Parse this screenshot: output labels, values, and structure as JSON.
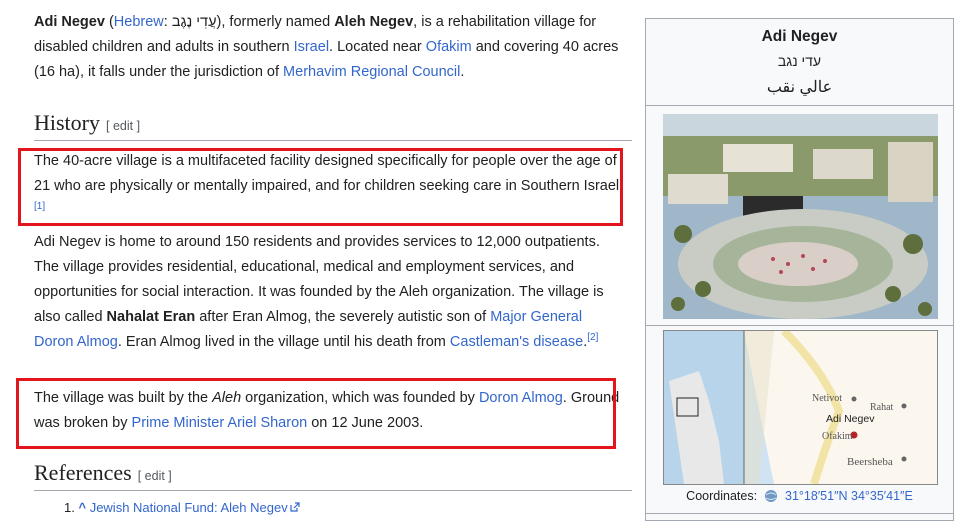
{
  "intro": {
    "title_bold": "Adi Negev",
    "open_paren": " (",
    "hebrew_link": "Hebrew",
    "hebrew_text": ": עֲדִי נֶגֶב",
    "close_part": "), formerly named ",
    "former_name": "Aleh Negev",
    "text1": ", is a rehabilitation village for disabled children and adults in southern ",
    "israel_link": "Israel",
    "text2": ". Located near ",
    "ofakim_link": "Ofakim",
    "text3": " and covering 40 acres (16 ha), it falls under the jurisdiction of ",
    "council_link": "Merhavim Regional Council",
    "text4": "."
  },
  "history": {
    "heading": "History",
    "edit": "[ edit ]",
    "p1": "The 40-acre village is a multifaceted facility designed specifically for people over the age of 21 who are physically or mentally impaired, and for children seeking care in Southern Israel.",
    "p1_ref": "[1]",
    "p2_a": "Adi Negev is home to around 150 residents and provides services to 12,000 outpatients. The village provides residential, educational, medical and employment services, and opportunities for social interaction. It was founded by the Aleh organization. The village is also called ",
    "p2_bold": "Nahalat Eran",
    "p2_b": " after Eran Almog, the severely autistic son of ",
    "p2_link1": "Major General Doron Almog",
    "p2_c": ". Eran Almog lived in the village until his death from ",
    "p2_link2": "Castleman's disease",
    "p2_d": ".",
    "p2_ref": "[2]",
    "p3_a": "The village was built by the ",
    "p3_italic": "Aleh",
    "p3_b": " organization, which was founded by ",
    "p3_link1": "Doron Almog",
    "p3_c": ". Ground was broken by ",
    "p3_link2": "Prime Minister Ariel Sharon",
    "p3_d": " on 12 June 2003."
  },
  "references": {
    "heading": "References",
    "edit": "[ edit ]",
    "item1_num": "1.",
    "item1_caret": "^",
    "item1_text": "Jewish National Fund: Aleh Negev"
  },
  "infobox": {
    "title": "Adi Negev",
    "hebrew": "עדי נגב",
    "arabic": "عالي نقب",
    "map_labels": {
      "netivot": "Netivot",
      "rahat": "Rahat",
      "adi_negev": "Adi Negev",
      "ofakim": "Ofakim",
      "beersheba": "Beersheba"
    },
    "coords_label": "Coordinates:",
    "coords_value": "31°18′51″N 34°35′41″E"
  },
  "colors": {
    "link": "#3366cc",
    "highlight": "#e3151c",
    "infobox_bg": "#f8f9fa"
  }
}
